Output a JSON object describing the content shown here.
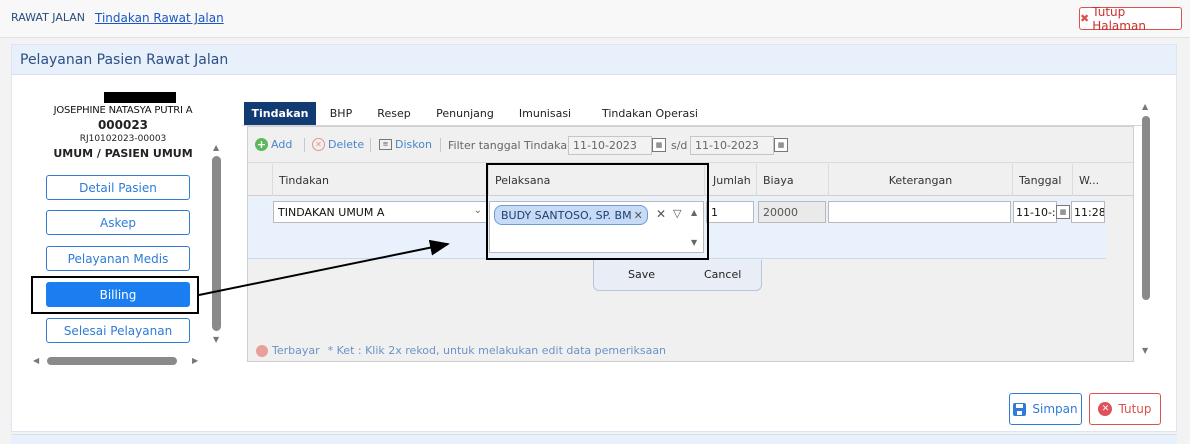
{
  "breadcrumb": {
    "root": "RAWAT JALAN",
    "current": "Tindakan Rawat Jalan"
  },
  "header": {
    "close_page": "Tutup Halaman"
  },
  "panel": {
    "title": "Pelayanan Pasien Rawat Jalan"
  },
  "patient": {
    "name": "JOSEPHINE NATASYA PUTRI A",
    "id": "000023",
    "registration": "RJ10102023-00003",
    "type": "UMUM / PASIEN UMUM"
  },
  "sidebar": {
    "items": [
      {
        "label": "Detail Pasien"
      },
      {
        "label": "Askep"
      },
      {
        "label": "Pelayanan Medis"
      },
      {
        "label": "Billing"
      },
      {
        "label": "Selesai Pelayanan"
      }
    ]
  },
  "tabs": [
    {
      "label": "Tindakan"
    },
    {
      "label": "BHP"
    },
    {
      "label": "Resep"
    },
    {
      "label": "Penunjang"
    },
    {
      "label": "Imunisasi"
    },
    {
      "label": "Tindakan Operasi"
    }
  ],
  "toolbar": {
    "add": "Add",
    "delete": "Delete",
    "diskon": "Diskon",
    "filter_label": "Filter tanggal Tindakan:",
    "date_from": "11-10-2023",
    "sd": "s/d",
    "date_to": "11-10-2023"
  },
  "grid": {
    "columns": [
      "Tindakan",
      "Pelaksana",
      "Jumlah",
      "Biaya",
      "Keterangan",
      "Tanggal",
      "W..."
    ],
    "row": {
      "tindakan": "TINDAKAN UMUM A",
      "pelaksana": "BUDY SANTOSO, SP. BM",
      "jumlah": "1",
      "biaya": "20000",
      "keterangan": "",
      "tanggal": "11-10-:",
      "waktu": "11:28"
    }
  },
  "row_editor": {
    "save": "Save",
    "cancel": "Cancel"
  },
  "legend": {
    "paid": "Terbayar",
    "note": "* Ket : Klik 2x rekod, untuk melakukan edit data pemeriksaan"
  },
  "footer": {
    "save": "Simpan",
    "close": "Tutup"
  },
  "colors": {
    "accent": "#1a7df0",
    "nav_active": "#123a73",
    "danger": "#d9534f"
  }
}
